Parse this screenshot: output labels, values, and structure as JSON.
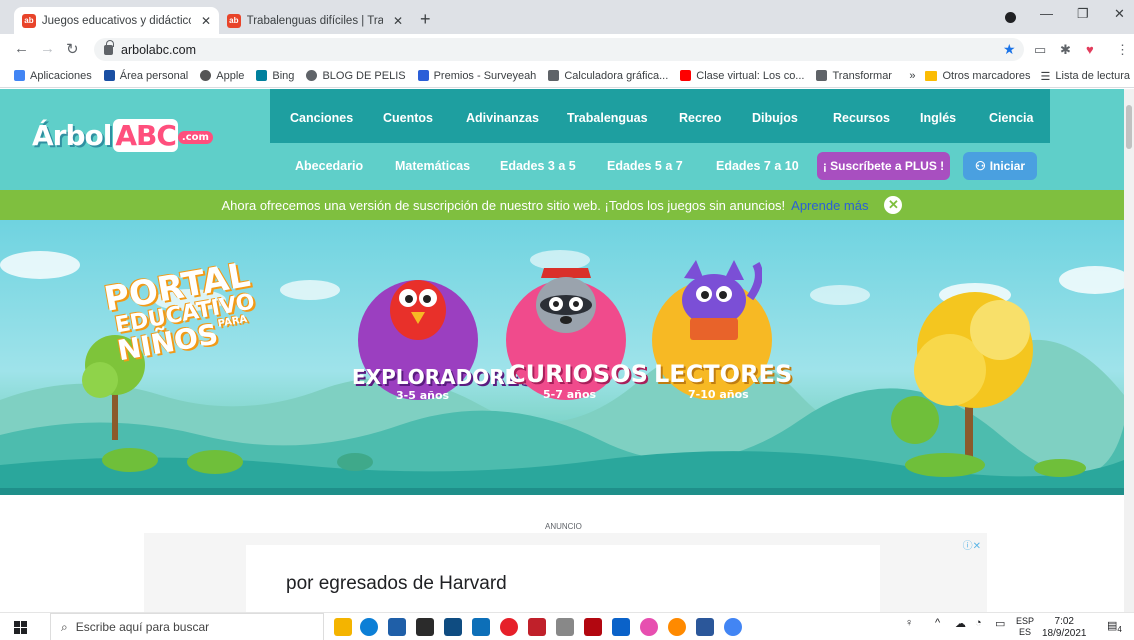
{
  "browser": {
    "tabs": [
      {
        "title": "Juegos educativos y didácticos o",
        "active": true
      },
      {
        "title": "Trabalenguas difíciles | Trabaleng",
        "active": false
      }
    ],
    "url": "arbolabc.com",
    "bookmarks": [
      {
        "label": "Aplicaciones",
        "icon": "apps-grid-icon",
        "color": "#4285f4"
      },
      {
        "label": "Área personal",
        "icon": "uc-icon",
        "color": "#1a4fa3"
      },
      {
        "label": "Apple",
        "icon": "apple-icon",
        "color": "#555555"
      },
      {
        "label": "Bing",
        "icon": "bing-icon",
        "color": "#00809d"
      },
      {
        "label": "BLOG DE PELIS",
        "icon": "globe-icon",
        "color": "#5f6368"
      },
      {
        "label": "Premios - Surveyeah",
        "icon": "surveyeah-icon",
        "color": "#2b5fd8"
      },
      {
        "label": "Calculadora gráfica...",
        "icon": "desmos-icon",
        "color": "#5f6368"
      },
      {
        "label": "Clase virtual: Los co...",
        "icon": "youtube-icon",
        "color": "#ff0000"
      },
      {
        "label": "Transformar",
        "icon": "shield-icon",
        "color": "#5f6368"
      }
    ],
    "bookmarks_overflow": "»",
    "other_bookmarks": "Otros marcadores",
    "reading_list": "Lista de lectura"
  },
  "site": {
    "logo": {
      "part1": "Árbol",
      "part2": "ABC",
      "suffix": ".com"
    },
    "menu_top": [
      "Canciones",
      "Cuentos",
      "Adivinanzas",
      "Trabalenguas",
      "Recreo",
      "Dibujos",
      "Recursos",
      "Inglés",
      "Ciencia"
    ],
    "menu_bottom": [
      "Abecedario",
      "Matemáticas",
      "Edades 3 a 5",
      "Edades 5 a 7",
      "Edades 7 a 10"
    ],
    "subscribe_button": "¡ Suscríbete a PLUS !",
    "login_button": "Iniciar",
    "banner": {
      "text": "Ahora ofrecemos una versión de suscripción de nuestro sitio web. ¡Todos los juegos sin anuncios!",
      "link": "Aprende más",
      "close": "✕"
    },
    "hero": {
      "portal_line1": "PORTAL",
      "portal_line2": "EDUCATIVO",
      "portal_line3": "NIÑOS",
      "portal_para": "PARA",
      "categories": [
        {
          "name": "EXPLORADORES",
          "ages": "3-5 años",
          "color": "#9b3fc0"
        },
        {
          "name": "CURIOSOS",
          "ages": "5-7 años",
          "color": "#f04b8c"
        },
        {
          "name": "LECTORES",
          "ages": "7-10 años",
          "color": "#f7b924"
        }
      ]
    },
    "ad": {
      "tag": "ANUNCIO",
      "text": "por egresados de Harvard"
    }
  },
  "taskbar": {
    "search_placeholder": "Escribe aquí para buscar",
    "lang_top": "ESP",
    "lang_bottom": "ES",
    "time": "7:02",
    "date": "18/9/2021",
    "notifications": "4"
  }
}
